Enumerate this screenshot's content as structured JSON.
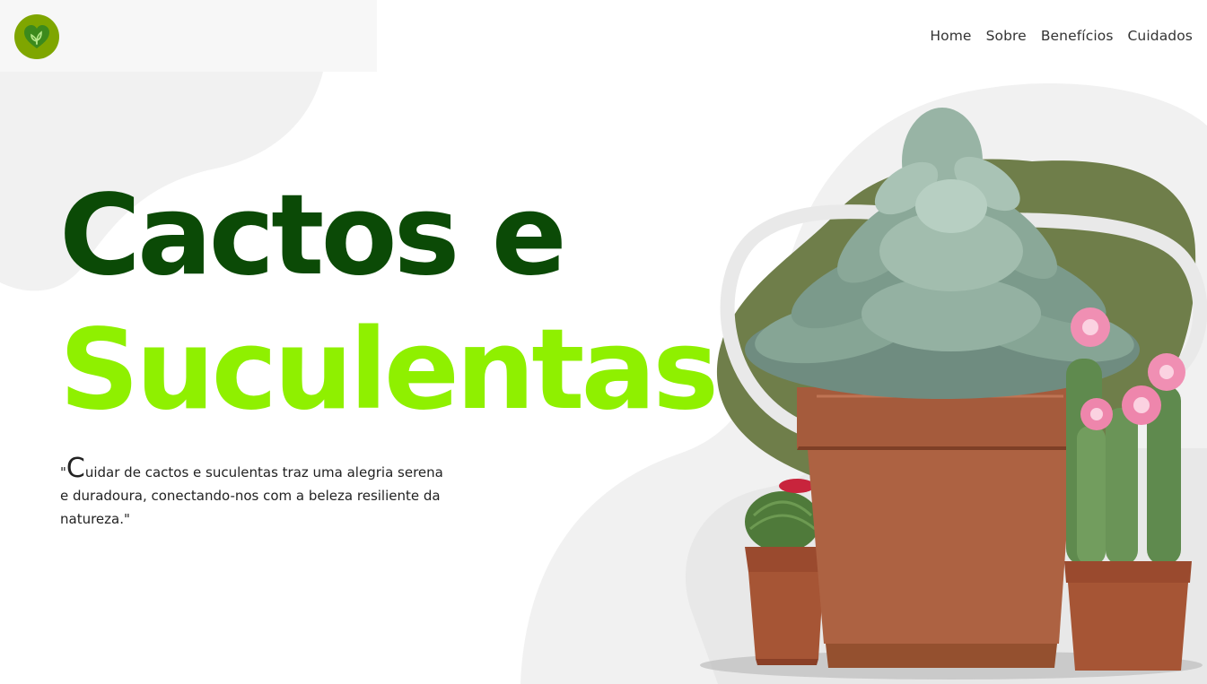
{
  "header": {
    "logo_icon": "leaf-heart-icon",
    "nav": [
      {
        "label": "Home"
      },
      {
        "label": "Sobre"
      },
      {
        "label": "Benefícios"
      },
      {
        "label": "Cuidados"
      }
    ]
  },
  "hero": {
    "title_line1": "Cactos e",
    "title_line2": "Suculentas",
    "quote_open": "\"",
    "quote_first_letter": "C",
    "quote_rest": "uidar de cactos e suculentas traz uma alegria serena e duradoura, conectando-nos com a beleza resiliente da natureza.\""
  },
  "colors": {
    "title_dark_green": "#0b4a06",
    "title_lime": "#8ff000",
    "logo_green": "#7fa600",
    "blob_olive": "#6f7e4a",
    "background_gray": "#f1f1f1"
  }
}
